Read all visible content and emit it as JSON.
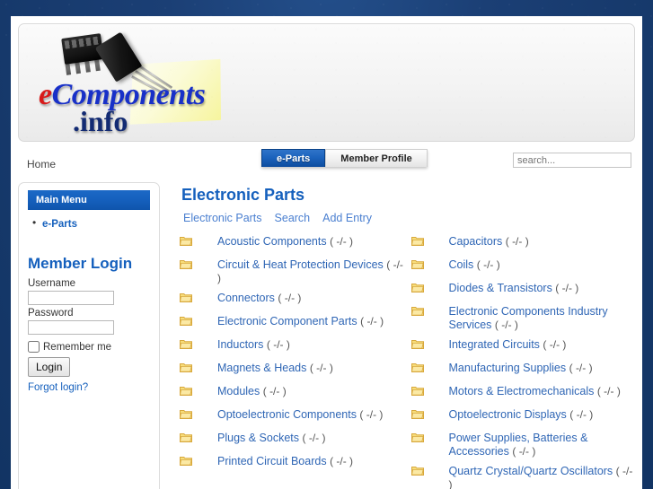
{
  "site": {
    "logo_text_e": "e",
    "logo_text_rest": "Components",
    "logo_info": ".info"
  },
  "tabs": [
    {
      "label": "e-Parts",
      "active": true
    },
    {
      "label": "Member Profile",
      "active": false
    }
  ],
  "topbar": {
    "breadcrumb": "Home",
    "search_placeholder": "search...",
    "search_value": ""
  },
  "sidebar": {
    "module_title": "Main Menu",
    "menu_items": [
      {
        "label": "e-Parts"
      }
    ],
    "login": {
      "title": "Member Login",
      "username_label": "Username",
      "username_value": "",
      "password_label": "Password",
      "password_value": "",
      "remember_label": "Remember me",
      "login_button": "Login",
      "forgot_link": "Forgot login?"
    }
  },
  "main": {
    "page_title": "Electronic Parts",
    "subnav": [
      {
        "label": "Electronic Parts"
      },
      {
        "label": "Search"
      },
      {
        "label": "Add Entry"
      }
    ],
    "categories_left": [
      {
        "name": "Acoustic Components",
        "count": "( -/- )"
      },
      {
        "name": "Circuit & Heat Protection Devices",
        "count": "( -/- )"
      },
      {
        "name": "Connectors",
        "count": "( -/- )"
      },
      {
        "name": "Electronic Component Parts",
        "count": "( -/- )"
      },
      {
        "name": "Inductors",
        "count": "( -/- )"
      },
      {
        "name": "Magnets & Heads",
        "count": "( -/- )"
      },
      {
        "name": "Modules",
        "count": "( -/- )"
      },
      {
        "name": "Optoelectronic Components",
        "count": "( -/- )"
      },
      {
        "name": "Plugs & Sockets",
        "count": "( -/- )"
      },
      {
        "name": "Printed Circuit Boards",
        "count": "( -/- )"
      }
    ],
    "categories_right": [
      {
        "name": "Capacitors",
        "count": "( -/- )"
      },
      {
        "name": "Coils",
        "count": "( -/- )"
      },
      {
        "name": "Diodes & Transistors",
        "count": "( -/- )"
      },
      {
        "name": "Electronic Components Industry Services",
        "count": "( -/- )"
      },
      {
        "name": "Integrated Circuits",
        "count": "( -/- )"
      },
      {
        "name": "Manufacturing Supplies",
        "count": "( -/- )"
      },
      {
        "name": "Motors & Electromechanicals",
        "count": "( -/- )"
      },
      {
        "name": "Optoelectronic Displays",
        "count": "( -/- )"
      },
      {
        "name": "Power Supplies, Batteries & Accessories",
        "count": "( -/- )"
      },
      {
        "name": "Quartz Crystal/Quartz Oscillators",
        "count": "( -/- )"
      }
    ]
  },
  "colors": {
    "page_background": "#163a6e",
    "accent_blue": "#1560bd",
    "link_blue": "#2f66b5",
    "folder_yellow": "#f5d76e",
    "logo_red": "#d81b1b"
  }
}
